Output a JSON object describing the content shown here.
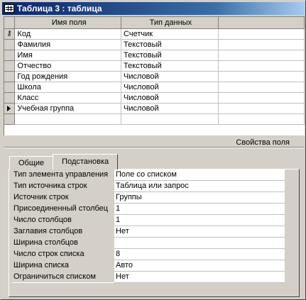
{
  "window": {
    "title": "Таблица 3 : таблица"
  },
  "grid": {
    "headers": {
      "field_name": "Имя поля",
      "data_type": "Тип данных"
    },
    "rows": [
      {
        "name": "Код",
        "type": "Счетчик",
        "marker": "key-icon"
      },
      {
        "name": "Фамилия",
        "type": "Текстовый"
      },
      {
        "name": "Имя",
        "type": "Текстовый"
      },
      {
        "name": "Отчество",
        "type": "Текстовый"
      },
      {
        "name": "Год рождения",
        "type": "Числовой"
      },
      {
        "name": "Школа",
        "type": "Числовой"
      },
      {
        "name": "Класс",
        "type": "Числовой"
      },
      {
        "name": "Учебная группа",
        "type": "Числовой",
        "marker": "current-row-arrow-icon"
      }
    ]
  },
  "properties": {
    "label": "Свойства поля",
    "tabs": [
      "Общие",
      "Подстановка"
    ],
    "active_tab": "Подстановка",
    "items": [
      {
        "name": "Тип элемента управления",
        "value": "Поле со списком"
      },
      {
        "name": "Тип источника строк",
        "value": "Таблица или запрос"
      },
      {
        "name": "Источник строк",
        "value": "Группы"
      },
      {
        "name": "Присоединенный столбец",
        "value": "1"
      },
      {
        "name": "Число столбцов",
        "value": "1"
      },
      {
        "name": "Заглавия столбцов",
        "value": "Нет"
      },
      {
        "name": "Ширина столбцов",
        "value": ""
      },
      {
        "name": "Число строк списка",
        "value": "8"
      },
      {
        "name": "Ширина списка",
        "value": "Авто"
      },
      {
        "name": "Ограничиться списком",
        "value": "Нет"
      }
    ]
  }
}
